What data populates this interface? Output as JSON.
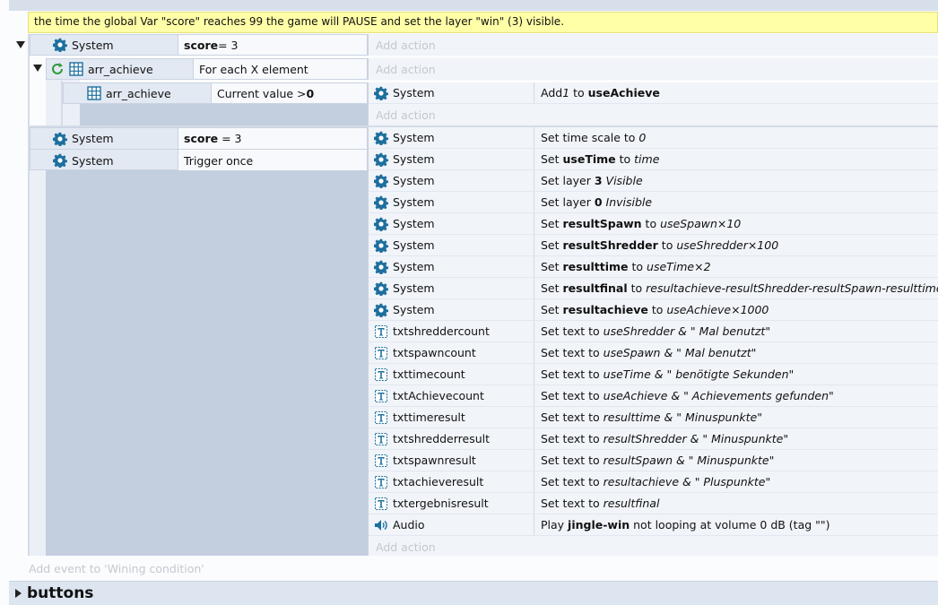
{
  "comment": "the time the global Var \"score\" reaches 99 the game will PAUSE and set the layer \"win\" (3) visible.",
  "add_action": "Add action",
  "add_event": "Add event to 'Wining condition'",
  "events": {
    "e1": {
      "cond_object": "System",
      "cond_var": "score",
      "cond_rest": " = 3"
    },
    "e2": {
      "cond_object": "arr_achieve",
      "cond_text": "For each X element"
    },
    "e3": {
      "cond_object": "arr_achieve",
      "cond_text": "Current value > ",
      "cond_value": "0",
      "action_object": "System",
      "action_pre": "Add ",
      "action_num": "1",
      "action_mid": " to ",
      "action_var": "useAchieve"
    },
    "e4": {
      "cond1_object": "System",
      "cond1_var": "score",
      "cond1_rest": " = 3",
      "cond2_object": "System",
      "cond2_text": "Trigger once"
    }
  },
  "actions": [
    {
      "object": "System",
      "icon": "gear",
      "parts": [
        [
          "n",
          "Set time scale to "
        ],
        [
          "i",
          "0"
        ]
      ]
    },
    {
      "object": "System",
      "icon": "gear",
      "parts": [
        [
          "n",
          "Set "
        ],
        [
          "b",
          "useTime"
        ],
        [
          "n",
          " to "
        ],
        [
          "i",
          "time"
        ]
      ]
    },
    {
      "object": "System",
      "icon": "gear",
      "parts": [
        [
          "n",
          "Set layer "
        ],
        [
          "b",
          "3"
        ],
        [
          "n",
          " "
        ],
        [
          "i",
          "Visible"
        ]
      ]
    },
    {
      "object": "System",
      "icon": "gear",
      "parts": [
        [
          "n",
          "Set layer "
        ],
        [
          "b",
          "0"
        ],
        [
          "n",
          " "
        ],
        [
          "i",
          "Invisible"
        ]
      ]
    },
    {
      "object": "System",
      "icon": "gear",
      "parts": [
        [
          "n",
          "Set "
        ],
        [
          "b",
          "resultSpawn"
        ],
        [
          "n",
          " to "
        ],
        [
          "i",
          "useSpawn×10"
        ]
      ]
    },
    {
      "object": "System",
      "icon": "gear",
      "parts": [
        [
          "n",
          "Set "
        ],
        [
          "b",
          "resultShredder"
        ],
        [
          "n",
          " to "
        ],
        [
          "i",
          "useShredder×100"
        ]
      ]
    },
    {
      "object": "System",
      "icon": "gear",
      "parts": [
        [
          "n",
          "Set "
        ],
        [
          "b",
          "resulttime"
        ],
        [
          "n",
          " to "
        ],
        [
          "i",
          "useTime×2"
        ]
      ]
    },
    {
      "object": "System",
      "icon": "gear",
      "parts": [
        [
          "n",
          "Set "
        ],
        [
          "b",
          "resultfinal"
        ],
        [
          "n",
          " to "
        ],
        [
          "i",
          "resultachieve-resultShredder-resultSpawn-resulttime"
        ]
      ]
    },
    {
      "object": "System",
      "icon": "gear",
      "parts": [
        [
          "n",
          "Set "
        ],
        [
          "b",
          "resultachieve"
        ],
        [
          "n",
          " to "
        ],
        [
          "i",
          "useAchieve×1000"
        ]
      ]
    },
    {
      "object": "txtshreddercount",
      "icon": "text",
      "parts": [
        [
          "n",
          "Set text to "
        ],
        [
          "i",
          "useShredder & \" Mal benutzt\""
        ]
      ]
    },
    {
      "object": "txtspawncount",
      "icon": "text",
      "parts": [
        [
          "n",
          "Set text to "
        ],
        [
          "i",
          "useSpawn & \" Mal benutzt\""
        ]
      ]
    },
    {
      "object": "txttimecount",
      "icon": "text",
      "parts": [
        [
          "n",
          "Set text to "
        ],
        [
          "i",
          "useTime & \" benötigte Sekunden\""
        ]
      ]
    },
    {
      "object": "txtAchievecount",
      "icon": "text",
      "parts": [
        [
          "n",
          "Set text to "
        ],
        [
          "i",
          "useAchieve & \" Achievements gefunden\""
        ]
      ]
    },
    {
      "object": "txttimeresult",
      "icon": "text",
      "parts": [
        [
          "n",
          "Set text to "
        ],
        [
          "i",
          "resulttime & \" Minuspunkte\""
        ]
      ]
    },
    {
      "object": "txtshredderresult",
      "icon": "text",
      "parts": [
        [
          "n",
          "Set text to "
        ],
        [
          "i",
          "resultShredder & \" Minuspunkte\""
        ]
      ]
    },
    {
      "object": "txtspawnresult",
      "icon": "text",
      "parts": [
        [
          "n",
          "Set text to "
        ],
        [
          "i",
          "resultSpawn & \" Minuspunkte\""
        ]
      ]
    },
    {
      "object": "txtachieveresult",
      "icon": "text",
      "parts": [
        [
          "n",
          "Set text to "
        ],
        [
          "i",
          "resultachieve & \" Pluspunkte\""
        ]
      ]
    },
    {
      "object": "txtergebnisresult",
      "icon": "text",
      "parts": [
        [
          "n",
          "Set text to "
        ],
        [
          "i",
          "resultfinal"
        ]
      ]
    },
    {
      "object": "Audio",
      "icon": "audio",
      "parts": [
        [
          "n",
          "Play "
        ],
        [
          "b",
          "jingle-win"
        ],
        [
          "n",
          " not looping at volume 0 dB (tag \"\")"
        ]
      ]
    }
  ],
  "next_group": "buttons",
  "colors": {
    "comment_bg": "#ffffa8",
    "condition_bg": "#e3e9f2",
    "action_bg": "#f1f4f9",
    "gear": "#1d6f9e"
  }
}
